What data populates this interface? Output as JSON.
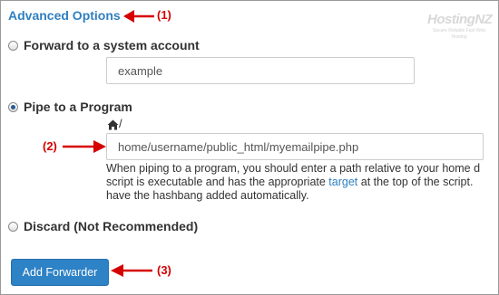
{
  "form": {
    "advanced_options": "Advanced Options",
    "logo_text": "HostingNZ",
    "logo_tagline": "Secure Reliable Fast Web Hosting",
    "options": [
      {
        "label": "Forward to a system account",
        "checked": false
      },
      {
        "label": "Pipe to a Program",
        "checked": true
      },
      {
        "label": "Discard (Not Recommended)",
        "checked": false
      }
    ],
    "system_account_value": "example",
    "home_path_suffix": "/",
    "pipe_path_value": "home/username/public_html/myemailpipe.php",
    "help_line1": "When piping to a program, you should enter a path relative to your home d",
    "help_line2_a": "script is executable and has the appropriate ",
    "help_link": "target",
    "help_line2_b": " at the top of the script.",
    "help_line3": "have the hashbang added automatically.",
    "submit_label": "Add Forwarder"
  },
  "annotations": {
    "callout_1": "(1)",
    "callout_2": "(2)",
    "callout_3": "(3)",
    "color": "#d60000"
  },
  "icons": {
    "caret": "caret-down-icon",
    "home": "home-icon",
    "arrow": "arrow-icon",
    "radio": "radio-icon"
  },
  "colors": {
    "link": "#2f7fc1",
    "button": "#2e82c6",
    "annotation": "#d60000"
  }
}
